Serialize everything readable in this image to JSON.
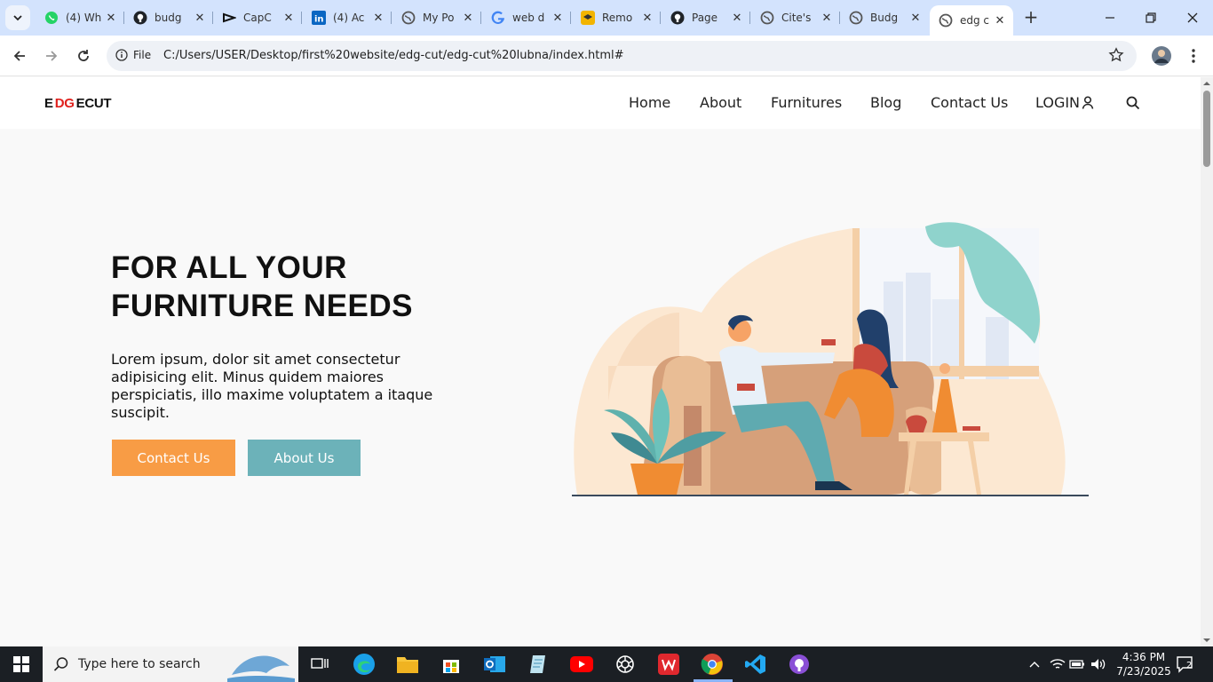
{
  "browser": {
    "tabs": [
      {
        "title": "(4) Wh",
        "icon": "whatsapp-icon"
      },
      {
        "title": "budg",
        "icon": "github-icon"
      },
      {
        "title": "CapC",
        "icon": "capcut-icon"
      },
      {
        "title": "(4) Ac",
        "icon": "linkedin-icon"
      },
      {
        "title": "My Po",
        "icon": "globe-icon"
      },
      {
        "title": "web d",
        "icon": "google-icon"
      },
      {
        "title": "Remo",
        "icon": "remote-icon"
      },
      {
        "title": "Page",
        "icon": "github-icon"
      },
      {
        "title": "Cite's",
        "icon": "globe-icon"
      },
      {
        "title": "Budg",
        "icon": "globe-icon"
      },
      {
        "title": "edg c",
        "icon": "globe-icon",
        "active": true
      }
    ],
    "omnibox": {
      "scheme_label": "File",
      "url": "C:/Users/USER/Desktop/first%20website/edg-cut/edg-cut%20lubna/index.html#"
    }
  },
  "site": {
    "logo": {
      "part1": "E",
      "part2": "DG",
      "part3": "ECUT"
    },
    "nav": {
      "home": "Home",
      "about": "About",
      "furnitures": "Furnitures",
      "blog": "Blog",
      "contact": "Contact Us",
      "login": "LOGIN"
    },
    "hero": {
      "title_line1": "FOR ALL YOUR",
      "title_line2": "FURNITURE NEEDS",
      "text": "Lorem ipsum, dolor sit amet consectetur adipisicing elit. Minus quidem maiores perspiciatis, illo maxime voluptatem a itaque suscipit.",
      "contact_button": "Contact Us",
      "about_button": "About Us"
    },
    "colors": {
      "contact_button": "#f89c45",
      "about_button": "#6cb2b9",
      "logo_accent": "#e0211d"
    }
  },
  "taskbar": {
    "search_placeholder": "Type here to search",
    "time": "4:36 PM",
    "date": "7/23/2025",
    "notification_count": "2"
  }
}
